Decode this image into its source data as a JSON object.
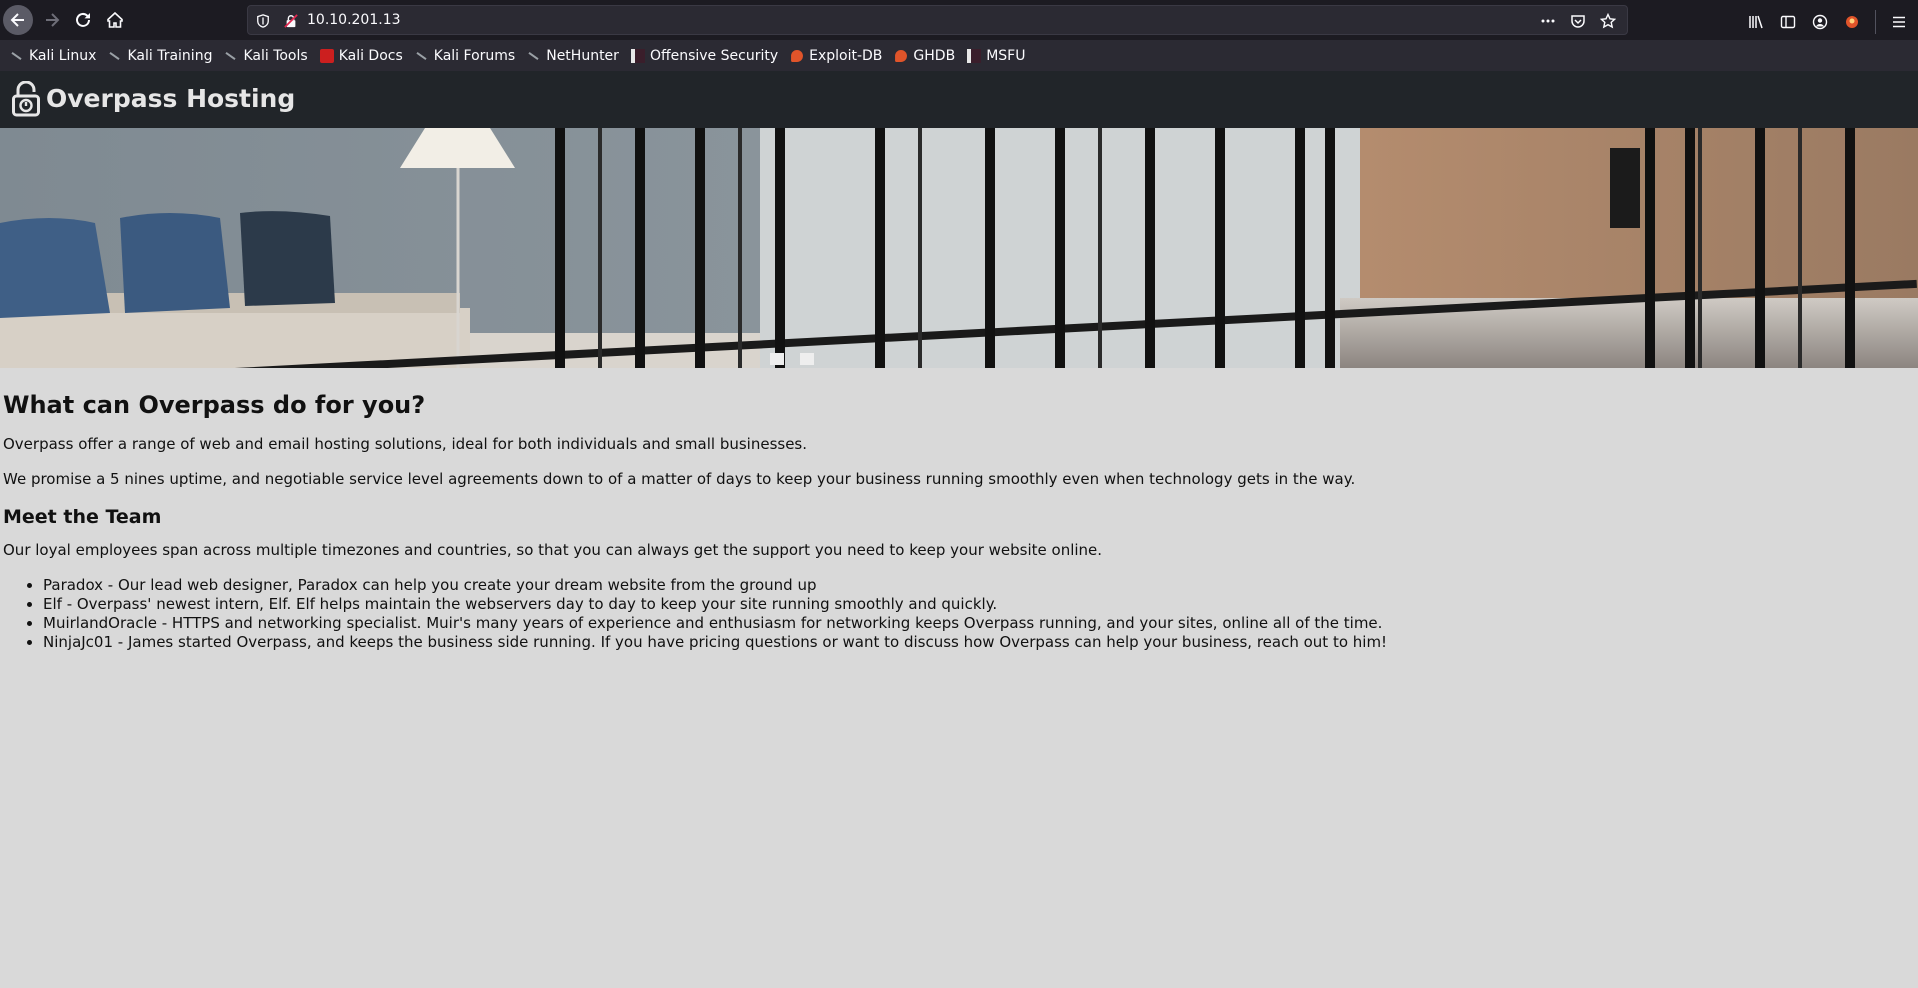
{
  "browser": {
    "url": "10.10.201.13",
    "icons": [
      "back-icon",
      "forward-icon",
      "reload-icon",
      "home-icon",
      "shield-icon",
      "insecure-lock-icon",
      "more-icon",
      "pocket-icon",
      "star-icon",
      "library-icon",
      "sidebar-icon",
      "account-icon",
      "extension-icon",
      "menu-icon"
    ]
  },
  "bookmarks": [
    {
      "label": "Kali Linux",
      "icon": "kali-dragon-icon"
    },
    {
      "label": "Kali Training",
      "icon": "kali-dragon-icon"
    },
    {
      "label": "Kali Tools",
      "icon": "kali-dragon-icon"
    },
    {
      "label": "Kali Docs",
      "icon": "kali-docs-icon"
    },
    {
      "label": "Kali Forums",
      "icon": "kali-dragon-icon"
    },
    {
      "label": "NetHunter",
      "icon": "kali-dragon-icon"
    },
    {
      "label": "Offensive Security",
      "icon": "offsec-icon"
    },
    {
      "label": "Exploit-DB",
      "icon": "exploit-db-icon"
    },
    {
      "label": "GHDB",
      "icon": "exploit-db-icon"
    },
    {
      "label": "MSFU",
      "icon": "offsec-icon"
    }
  ],
  "site": {
    "title": "Overpass Hosting",
    "heading": "What can Overpass do for you?",
    "intro": "Overpass offer a range of web and email hosting solutions, ideal for both individuals and small businesses.",
    "promise": "We promise a 5 nines uptime, and negotiable service level agreements down to of a matter of days to keep your business running smoothly even when technology gets in the way.",
    "team_heading": "Meet the Team",
    "team_intro": "Our loyal employees span across multiple timezones and countries, so that you can always get the support you need to keep your website online.",
    "team": [
      "Paradox - Our lead web designer, Paradox can help you create your dream website from the ground up",
      "Elf - Overpass' newest intern, Elf. Elf helps maintain the webservers day to day to keep your site running smoothly and quickly.",
      "MuirlandOracle - HTTPS and networking specialist. Muir's many years of experience and enthusiasm for networking keeps Overpass running, and your sites, online all of the time.",
      "NinjaJc01 - James started Overpass, and keeps the business side running. If you have pricing questions or want to discuss how Overpass can help your business, reach out to him!"
    ]
  },
  "colors": {
    "chrome": "#1c1b22",
    "bookmarks_bar": "#2b2a33",
    "site_header": "#212529",
    "page_bg": "#d9d9d9"
  }
}
